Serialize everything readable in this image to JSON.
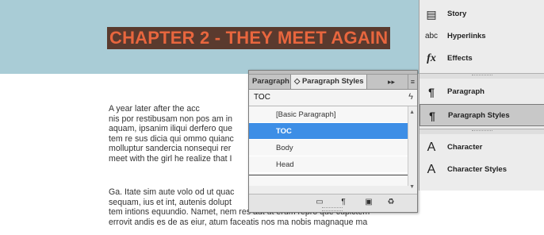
{
  "document": {
    "chapter_title": "CHAPTER 2 - THEY MEET AGAIN",
    "paragraph1": [
      "           A year later after the acc",
      "nis por restibusam non pos am in",
      "aquam, ipsanim iliqui derfero que",
      "tem re sus dicia qui ommo quianc",
      "molluptur sandercia nonsequi rer",
      "meet with the girl he realize that I"
    ],
    "paragraph2": [
      "Ga. Itate sim aute volo od ut quac",
      "sequam, ius et int, autenis dolupt",
      "tem intions equundio. Namet, nem res aut ut erum repro que cupictem",
      "errovit andis es de as eiur, atum faceatis nos ma nobis magnaque ma"
    ]
  },
  "paragraph_styles_panel": {
    "tab_paragraph": "Paragraph",
    "tab_styles": "◇ Paragraph Styles",
    "collapse_glyph": "▸▸",
    "menu_glyph": "≡",
    "current_style": "TOC",
    "lightning_glyph": "ϟ",
    "styles": [
      {
        "label": "[Basic Paragraph]",
        "selected": false
      },
      {
        "label": "TOC",
        "selected": true
      },
      {
        "label": "Body",
        "selected": false
      },
      {
        "label": "Head",
        "selected": false
      }
    ],
    "footer_icons": [
      "folder-icon",
      "clear-overrides-icon",
      "new-style-icon",
      "delete-icon"
    ]
  },
  "dock": {
    "items": [
      {
        "label": "Story",
        "icon": "story-icon",
        "glyph": "▤"
      },
      {
        "label": "Hyperlinks",
        "icon": "hyperlinks-icon",
        "glyph": "abc"
      },
      {
        "label": "Effects",
        "icon": "effects-icon",
        "glyph": "fx"
      },
      {
        "label": "Paragraph",
        "icon": "pilcrow-icon",
        "glyph": "¶"
      },
      {
        "label": "Paragraph Styles",
        "icon": "paragraph-styles-icon",
        "glyph": "¶"
      },
      {
        "label": "Character",
        "icon": "character-icon",
        "glyph": "A"
      },
      {
        "label": "Character Styles",
        "icon": "character-styles-icon",
        "glyph": "A"
      }
    ]
  },
  "colors": {
    "banner": "#a9ccd6",
    "title_bg": "#5a3a2e",
    "title_text": "#e8663e",
    "selection": "#3d8ee6"
  }
}
